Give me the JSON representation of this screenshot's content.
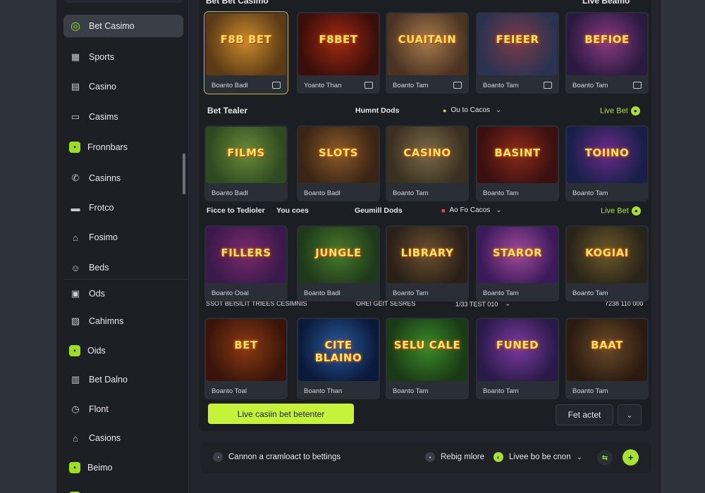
{
  "sidebar": {
    "items": [
      {
        "label": "Bet Casimo",
        "icon": "search-icon",
        "active": true
      },
      {
        "label": "Sports",
        "icon": "grid-icon"
      },
      {
        "label": "Casino",
        "icon": "casino-icon"
      },
      {
        "label": "Casims",
        "icon": "card-icon"
      },
      {
        "label": "Fronnbars",
        "icon": "green-square-icon"
      },
      {
        "label": "Casinns",
        "icon": "phone-icon"
      },
      {
        "label": "Frotco",
        "icon": "film-icon"
      },
      {
        "label": "Fosimo",
        "icon": "building-icon"
      },
      {
        "label": "Beds",
        "icon": "user-icon"
      },
      {
        "label": "Ods",
        "icon": "bag-icon"
      },
      {
        "label": "Cahimns",
        "icon": "chart-icon"
      },
      {
        "label": "Oids",
        "icon": "green-box-icon"
      },
      {
        "label": "Bet Dalno",
        "icon": "table-icon"
      },
      {
        "label": "Flont",
        "icon": "clock-icon"
      },
      {
        "label": "Casions",
        "icon": "lock-icon"
      },
      {
        "label": "Beimo",
        "icon": "green-tile-icon"
      }
    ]
  },
  "sections": {
    "top": {
      "title": "Bet Bet Casimo",
      "right": "Live Beamo"
    },
    "row2": {
      "title": "Bet Tealer",
      "mid": "Humnt Dods",
      "filter": "Ou to Cacos",
      "right": "Live Bet"
    },
    "row3": {
      "title": "Ficce to Tedioler",
      "sub": "You coes",
      "mid": "Geumill Dods",
      "filter": "Ao Fo Cacos",
      "right": "Live Bet"
    },
    "row4": {
      "left": "SSOT BEISILIT TRIEES CESIMNIS",
      "mid": "OREI GEIT SESRES",
      "filter": "1/33 TEST 010",
      "right": "7238 110 000"
    }
  },
  "rows": [
    [
      {
        "title": "F8B BET",
        "name": "Boanto Badl",
        "colors": [
          "#5b3a16",
          "#c98a2a"
        ]
      },
      {
        "title": "F8BET",
        "name": "Yoanto Than",
        "colors": [
          "#3a0e0a",
          "#a02a12"
        ]
      },
      {
        "title": "CUAITAIN",
        "name": "Boanto Tam",
        "colors": [
          "#4b3322",
          "#a67b4d"
        ]
      },
      {
        "title": "FEIEER",
        "name": "Boanto Tam",
        "colors": [
          "#2b3350",
          "#7a3a4a"
        ]
      },
      {
        "title": "BEFIOE",
        "name": "Boanto Tam",
        "colors": [
          "#2a1a40",
          "#8a3a80"
        ]
      }
    ],
    [
      {
        "title": "FILMS",
        "name": "Boanto Badl",
        "colors": [
          "#2f4a20",
          "#6a8a3a"
        ]
      },
      {
        "title": "SLOTS",
        "name": "Boanto Badl",
        "colors": [
          "#3a2414",
          "#8a5a2a"
        ]
      },
      {
        "title": "CASINO",
        "name": "Boanto Tam",
        "colors": [
          "#3a3020",
          "#7a6a4a"
        ]
      },
      {
        "title": "BASINT",
        "name": "Boanto Tam",
        "colors": [
          "#3a1010",
          "#8a2a1a"
        ]
      },
      {
        "title": "TOIINO",
        "name": "Boanto Tam",
        "colors": [
          "#18204a",
          "#6a2a8a"
        ]
      }
    ],
    [
      {
        "title": "FILLERS",
        "name": "Boanto Ooal",
        "colors": [
          "#3a1a4a",
          "#7a2a6a"
        ]
      },
      {
        "title": "JUNGLE",
        "name": "Boanto Badl",
        "colors": [
          "#1e3a1a",
          "#4a7a2a"
        ]
      },
      {
        "title": "LIBRARY",
        "name": "Boanto Tam",
        "colors": [
          "#2a2018",
          "#6a5030"
        ]
      },
      {
        "title": "STAROR",
        "name": "Boanto Tam",
        "colors": [
          "#3a1a5a",
          "#a04a9a"
        ]
      },
      {
        "title": "KOGIAI",
        "name": "Boanto Tam",
        "colors": [
          "#2a2418",
          "#6a5a2a"
        ]
      }
    ],
    [
      {
        "title": "BET",
        "name": "Boanto Toal",
        "colors": [
          "#3a140a",
          "#8a3a14"
        ]
      },
      {
        "title": "CITE BLAINO",
        "name": "Boanto Than",
        "colors": [
          "#0a1a3a",
          "#2a5a9a"
        ]
      },
      {
        "title": "SELU CALE",
        "name": "Boanto Tam",
        "colors": [
          "#1a3a14",
          "#3a8a2a"
        ]
      },
      {
        "title": "FUNED",
        "name": "Boanto Tam",
        "colors": [
          "#2a1a4a",
          "#7a3aa0"
        ]
      },
      {
        "title": "BAAT",
        "name": "Boanto Tam",
        "colors": [
          "#2a1a10",
          "#6a4a2a"
        ]
      }
    ]
  ],
  "actions": {
    "cta": "Live casiin bet betenter",
    "secondary": "Fet actet",
    "more": "⌄"
  },
  "footer": {
    "left": "Cannon a cramloact to bettings",
    "mid": "Rebig mlore",
    "live": "Livee bo be cnon"
  },
  "colors": {
    "accent": "#a6e22e",
    "cta": "#c7f23a",
    "panel": "#1b1e23"
  }
}
